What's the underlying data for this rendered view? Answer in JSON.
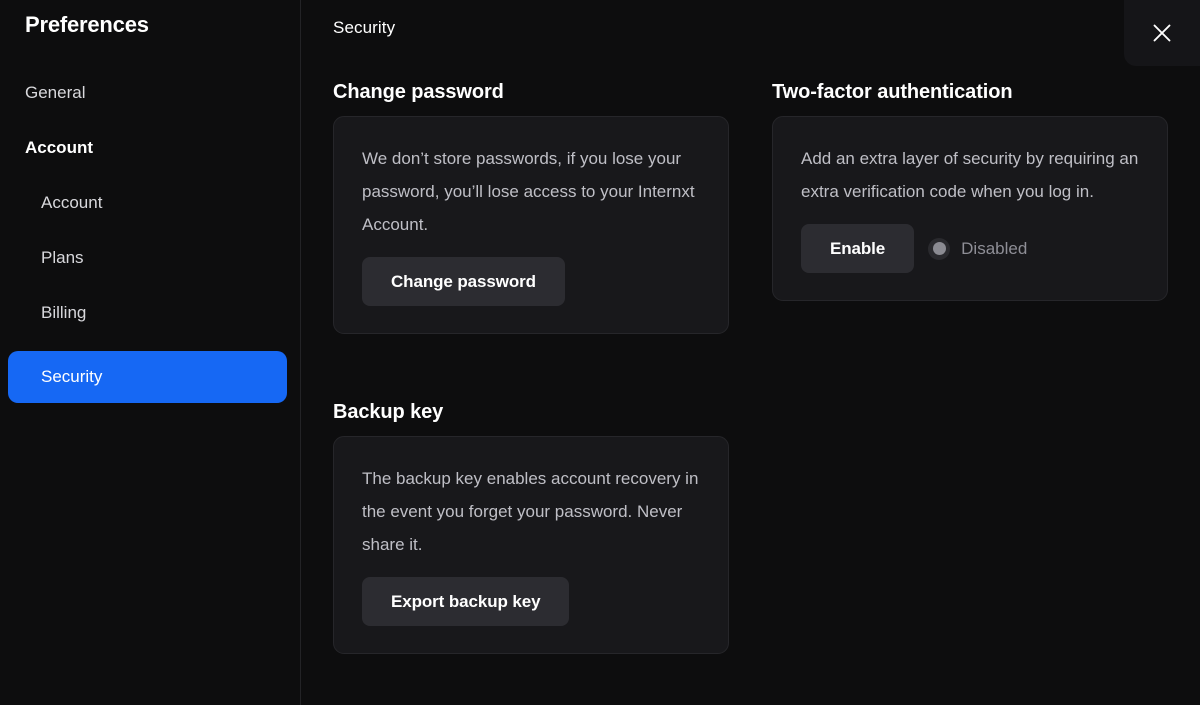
{
  "sidebar": {
    "title": "Preferences",
    "items": [
      {
        "label": "General",
        "type": "item",
        "selected": false
      },
      {
        "label": "Account",
        "type": "group-header",
        "selected": false
      },
      {
        "label": "Account",
        "type": "sub",
        "selected": false
      },
      {
        "label": "Plans",
        "type": "sub",
        "selected": false
      },
      {
        "label": "Billing",
        "type": "sub",
        "selected": false
      },
      {
        "label": "Security",
        "type": "sub",
        "selected": true
      }
    ]
  },
  "header": {
    "title": "Security",
    "close_icon": "close-icon"
  },
  "sections": {
    "change_password": {
      "title": "Change password",
      "description": "We don’t store passwords, if you lose your password, you’ll lose access to your Internxt Account.",
      "button_label": "Change password"
    },
    "two_factor": {
      "title": "Two-factor authentication",
      "description": "Add an extra layer of security by requiring an extra verification code when you log in.",
      "button_label": "Enable",
      "status_label": "Disabled",
      "status_icon": "circle-dot-icon"
    },
    "backup_key": {
      "title": "Backup key",
      "description": "The backup key enables account recovery in the event you forget your password. Never share it.",
      "button_label": "Export backup key"
    }
  },
  "colors": {
    "accent": "#1668f4",
    "page_background": "#0d0d0e",
    "card_background": "#18181b",
    "card_border": "#26262a",
    "button_background": "#2c2c31",
    "body_text": "#bfbfc6",
    "muted_text": "#8e8e96"
  }
}
